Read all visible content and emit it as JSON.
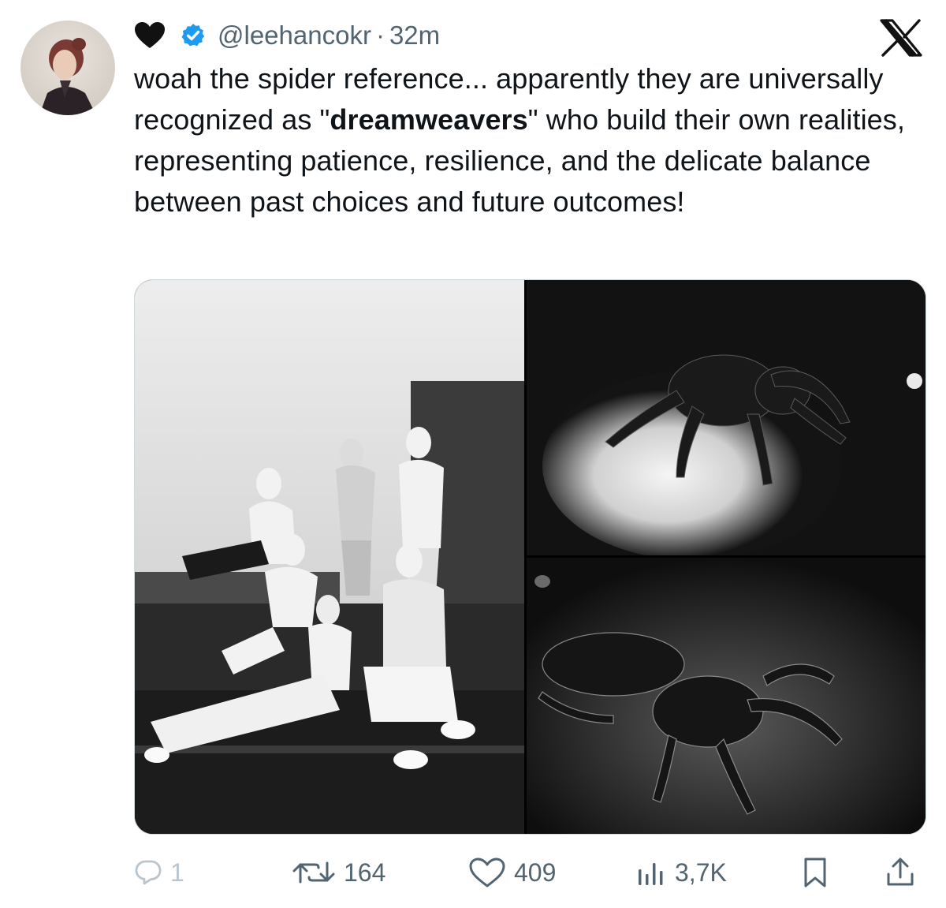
{
  "tweet": {
    "author_emoji_icon": "black-heart-icon",
    "verified_icon": "verified-badge-icon",
    "handle": "@leehancokr",
    "separator": "·",
    "time": "32m",
    "text_before_bold": "woah the spider reference... apparently they are universally recognized as \"",
    "text_bold": "dreamweavers",
    "text_after_bold": "\" who build their own realities, representing patience, resilience, and the delicate balance between past choices and future outcomes!"
  },
  "brand": {
    "logo_icon": "x-logo-icon"
  },
  "media": {
    "images": [
      "group-photo",
      "spider-photo-top",
      "spider-photo-bottom"
    ]
  },
  "actions": {
    "reply_count": "1",
    "retweet_count": "164",
    "like_count": "409",
    "views_count": "3,7K"
  },
  "colors": {
    "text": "#0f1419",
    "secondary": "#536471",
    "verified": "#1d9bf0"
  }
}
